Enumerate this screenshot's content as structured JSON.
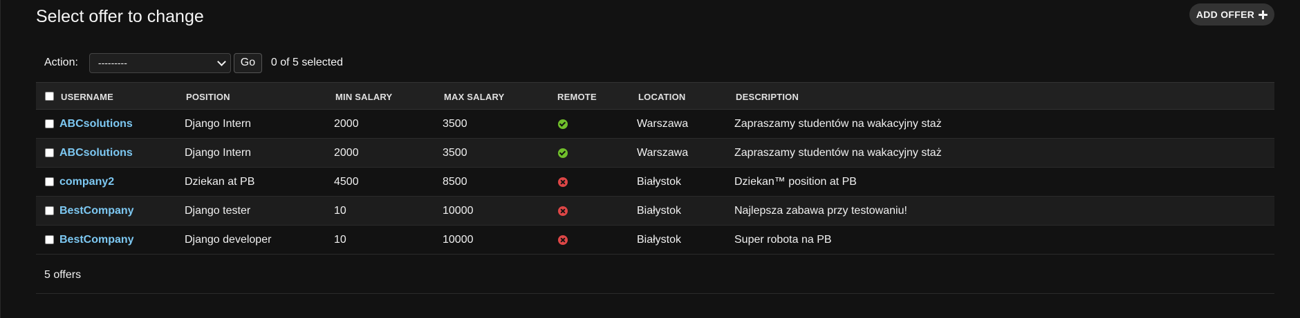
{
  "header": {
    "title": "Select offer to change",
    "add_button_label": "ADD OFFER"
  },
  "actions": {
    "label": "Action:",
    "select_value": "---------",
    "go_label": "Go",
    "selected_text": "0 of 5 selected"
  },
  "table": {
    "columns": [
      "USERNAME",
      "POSITION",
      "MIN SALARY",
      "MAX SALARY",
      "REMOTE",
      "LOCATION",
      "DESCRIPTION"
    ],
    "rows": [
      {
        "username": "ABCsolutions",
        "position": "Django Intern",
        "min_salary": "2000",
        "max_salary": "3500",
        "remote": "yes-icon",
        "location": "Warszawa",
        "description": "Zapraszamy studentów na wakacyjny staż"
      },
      {
        "username": "ABCsolutions",
        "position": "Django Intern",
        "min_salary": "2000",
        "max_salary": "3500",
        "remote": "yes-icon",
        "location": "Warszawa",
        "description": "Zapraszamy studentów na wakacyjny staż"
      },
      {
        "username": "company2",
        "position": "Dziekan at PB",
        "min_salary": "4500",
        "max_salary": "8500",
        "remote": "no-icon",
        "location": "Białystok",
        "description": "Dziekan™ position at PB"
      },
      {
        "username": "BestCompany",
        "position": "Django tester",
        "min_salary": "10",
        "max_salary": "10000",
        "remote": "no-icon",
        "location": "Białystok",
        "description": "Najlepsza zabawa przy testowaniu!"
      },
      {
        "username": "BestCompany",
        "position": "Django developer",
        "min_salary": "10",
        "max_salary": "10000",
        "remote": "no-icon",
        "location": "Białystok",
        "description": "Super robota na PB"
      }
    ]
  },
  "footer": {
    "count_text": "5 offers"
  },
  "colors": {
    "background": "#121212",
    "link": "#7dc8f2",
    "yes": "#70bf2b",
    "no": "#dd4646"
  }
}
